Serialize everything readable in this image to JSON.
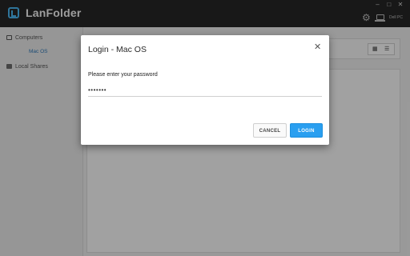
{
  "app": {
    "name": "LanFolder",
    "device_name": "Dell PC",
    "window_controls": [
      "–",
      "□",
      "✕"
    ]
  },
  "sidebar": {
    "computers_label": "Computers",
    "selected_item": "Mac OS",
    "local_shares_label": "Local Shares"
  },
  "dialog": {
    "title": "Login - Mac OS",
    "prompt": "Please enter your password",
    "password_value": "•••••••",
    "cancel_label": "CANCEL",
    "login_label": "LOGIN"
  },
  "colors": {
    "accent": "#2a9ff0",
    "titlebar": "#262626",
    "selected_text": "#2e77b6"
  }
}
